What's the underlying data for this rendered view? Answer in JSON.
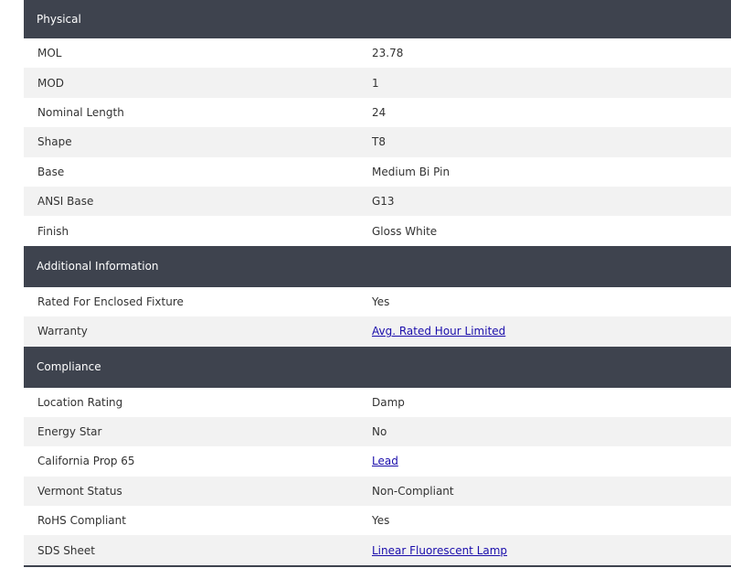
{
  "sections": {
    "physical": {
      "title": "Physical",
      "rows": [
        {
          "label": "MOL",
          "value": "23.78"
        },
        {
          "label": "MOD",
          "value": "1"
        },
        {
          "label": "Nominal Length",
          "value": "24"
        },
        {
          "label": "Shape",
          "value": "T8"
        },
        {
          "label": "Base",
          "value": "Medium Bi Pin"
        },
        {
          "label": "ANSI Base",
          "value": "G13"
        },
        {
          "label": "Finish",
          "value": "Gloss White"
        }
      ]
    },
    "additional": {
      "title": "Additional Information",
      "rows": [
        {
          "label": "Rated For Enclosed Fixture",
          "value": "Yes"
        },
        {
          "label": "Warranty",
          "value": "Avg. Rated Hour Limited",
          "link": true
        }
      ]
    },
    "compliance": {
      "title": "Compliance",
      "rows": [
        {
          "label": "Location Rating",
          "value": "Damp"
        },
        {
          "label": "Energy Star",
          "value": "No"
        },
        {
          "label": "California Prop 65",
          "value": "Lead",
          "link": true
        },
        {
          "label": "Vermont Status",
          "value": "Non-Compliant"
        },
        {
          "label": "RoHS Compliant",
          "value": "Yes"
        },
        {
          "label": "SDS Sheet",
          "value": "Linear Fluorescent Lamp",
          "link": true
        }
      ]
    }
  },
  "colors": {
    "header_bg": "#3e434e",
    "row_alt_bg": "#f2f2f2",
    "link": "#1a0dab"
  }
}
